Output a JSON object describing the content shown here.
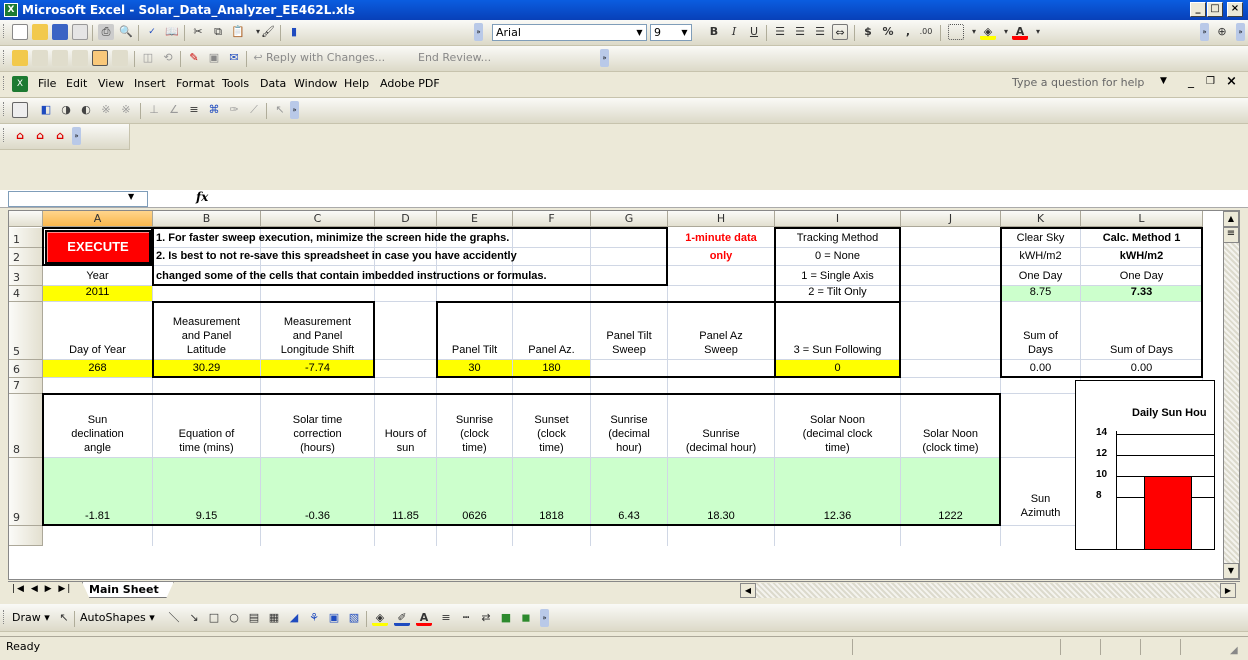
{
  "window": {
    "title": "Microsoft Excel - Solar_Data_Analyzer_EE462L.xls",
    "app_icon": "X"
  },
  "formatting": {
    "font_name": "Arial",
    "font_size": "9"
  },
  "reviewing": {
    "reply_changes": "Reply with Changes...",
    "end_review": "End Review..."
  },
  "menu": {
    "items": [
      "File",
      "Edit",
      "View",
      "Insert",
      "Format",
      "Tools",
      "Data",
      "Window",
      "Help",
      "Adobe PDF"
    ],
    "help_placeholder": "Type a question for help"
  },
  "formula_bar": {
    "name_box": "",
    "fx": "fx",
    "content": ""
  },
  "columns": [
    "A",
    "B",
    "C",
    "D",
    "E",
    "F",
    "G",
    "H",
    "I",
    "J",
    "K",
    "L"
  ],
  "rows": [
    "1",
    "2",
    "3",
    "4",
    "5",
    "6",
    "7",
    "8",
    "9"
  ],
  "cells": {
    "A1": "EXECUTE",
    "B1": "1. For faster sweep execution, minimize the screen hide the graphs.",
    "B2": "2. Is best to not re-save this spreadsheet in case you have accidently",
    "B3": "changed some of the cells that contain imbedded instructions or formulas.",
    "H1": "1-minute data",
    "H2": "only",
    "I1": "Tracking Method",
    "I2": "0 = None",
    "I3": "1 = Single Axis",
    "I4": "2 = Tilt Only",
    "I5": "3 = Sun Following",
    "I6": "0",
    "K1": "Clear Sky",
    "K2": "kWH/m2",
    "K3": "One Day",
    "K4": "8.75",
    "K5": "Sum of\nDays",
    "K6": "0.00",
    "L1": "Calc. Method 1",
    "L2": "kWH/m2",
    "L3": "One Day",
    "L4": "7.33",
    "L5": "Sum of Days",
    "L6": "0.00",
    "A3": "Year",
    "A4": "2011",
    "A5": "Day of Year",
    "A6": "268",
    "B5": "Measurement\nand Panel\nLatitude",
    "B6": "30.29",
    "C5": "Measurement\nand Panel\nLongitude Shift",
    "C6": "-7.74",
    "E5": "Panel Tilt",
    "E6": "30",
    "F5": "Panel Az.",
    "F6": "180",
    "G5": "Panel Tilt\nSweep",
    "H5": "Panel Az\nSweep",
    "A8": "Sun\ndeclination\nangle",
    "B8": "Equation of\ntime (mins)",
    "C8": "Solar time\ncorrection\n(hours)",
    "D8": "Hours of\nsun",
    "E8": "Sunrise\n(clock\ntime)",
    "F8": "Sunset\n(clock\ntime)",
    "G8": "Sunrise\n(decimal\nhour)",
    "H8": "Sunrise\n(decimal hour)",
    "I8": "Solar Noon\n(decimal clock\ntime)",
    "J8": "Solar Noon\n(clock time)",
    "A9": "-1.81",
    "B9": "9.15",
    "C9": "-0.36",
    "D9": "11.85",
    "E9": "0626",
    "F9": "1818",
    "G9": "6.43",
    "H9": "18.30",
    "I9": "12.36",
    "J9": "1222",
    "K9": "Sun\nAzimuth"
  },
  "chart": {
    "title": "Daily Sun Hou",
    "ticks": [
      "14",
      "12",
      "10",
      "8"
    ],
    "bar_color": "#ff0000"
  },
  "sheet_tabs": [
    "Main Sheet"
  ],
  "drawing": {
    "draw_label": "Draw",
    "autoshapes_label": "AutoShapes"
  },
  "status": "Ready",
  "colors": {
    "title_bar": "#0a5de0",
    "execute_bg": "#ff0000",
    "input_yellow": "#ffff00",
    "result_green": "#ccffcc"
  }
}
